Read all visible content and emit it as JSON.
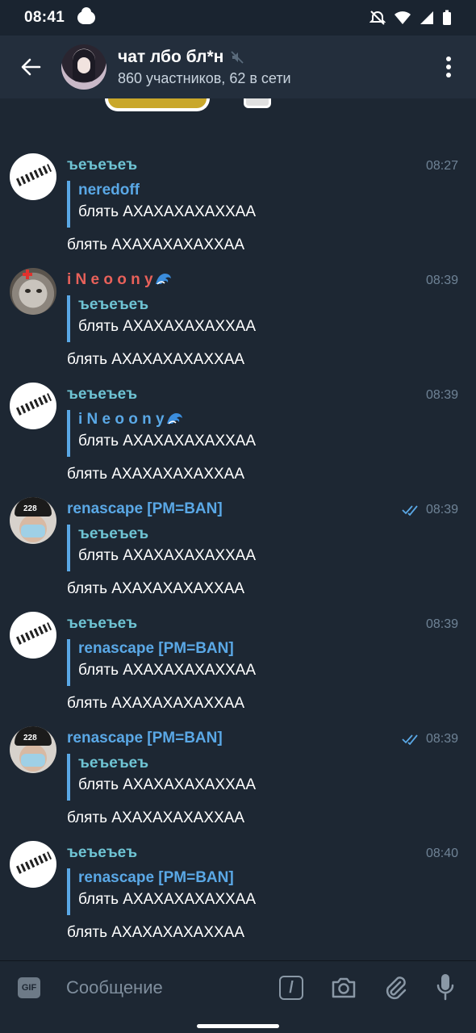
{
  "status_bar": {
    "time": "08:41"
  },
  "header": {
    "title": "чат лбо бл*н",
    "subtitle": "860 участников, 62 в сети"
  },
  "colors": {
    "sender_teal": "#6fc4d4",
    "sender_red": "#e8615a",
    "sender_blue": "#5aa8e6",
    "background": "#1d2733",
    "header": "#232e3c",
    "time": "#6f8396"
  },
  "messages": [
    {
      "sender": "ъеъеъеъ",
      "time": "08:27",
      "reply_name": "neredoff",
      "reply_text": "блять АХАХАХАХАХХАА",
      "text": "блять АХАХАХАХАХХАА",
      "avatar": "white-scribble"
    },
    {
      "sender": "i N e o o n y",
      "time": "08:39",
      "reply_name": "ъеъеъеъ",
      "reply_text": "блять АХАХАХАХАХХАА",
      "text": "блять АХАХАХАХАХХАА",
      "avatar": "cat"
    },
    {
      "sender": "ъеъеъеъ",
      "time": "08:39",
      "reply_name": "i N e o o n y",
      "reply_text": "блять АХАХАХАХАХХАА",
      "text": "блять АХАХАХАХАХХАА",
      "avatar": "white-scribble"
    },
    {
      "sender": "renascape [PM=BAN]",
      "time": "08:39",
      "reply_name": "ъеъеъеъ",
      "reply_text": "блять АХАХАХАХАХХАА",
      "text": "блять АХАХАХАХАХХАА",
      "avatar": "person-228"
    },
    {
      "sender": "ъеъеъеъ",
      "time": "08:39",
      "reply_name": "renascape [PM=BAN]",
      "reply_text": "блять АХАХАХАХАХХАА",
      "text": "блять АХАХАХАХАХХАА",
      "avatar": "white-scribble"
    },
    {
      "sender": "renascape [PM=BAN]",
      "time": "08:39",
      "reply_name": "ъеъеъеъ",
      "reply_text": "блять АХАХАХАХАХХАА",
      "text": "блять АХАХАХАХАХХАА",
      "avatar": "person-228"
    },
    {
      "sender": "ъеъеъеъ",
      "time": "08:40",
      "reply_name": "renascape [PM=BAN]",
      "reply_text": "блять АХАХАХАХАХХАА",
      "text": "блять АХАХАХАХАХХАА",
      "avatar": "white-scribble"
    }
  ],
  "avatar_label_228": "228",
  "input": {
    "placeholder": "Сообщение",
    "gif_label": "GIF"
  },
  "icons": [
    "back-arrow-icon",
    "mute-icon",
    "more-vertical-icon",
    "double-check-icon",
    "gif-icon",
    "slash-commands-icon",
    "camera-icon",
    "attach-clip-icon",
    "microphone-icon",
    "wave-emoji-icon"
  ]
}
